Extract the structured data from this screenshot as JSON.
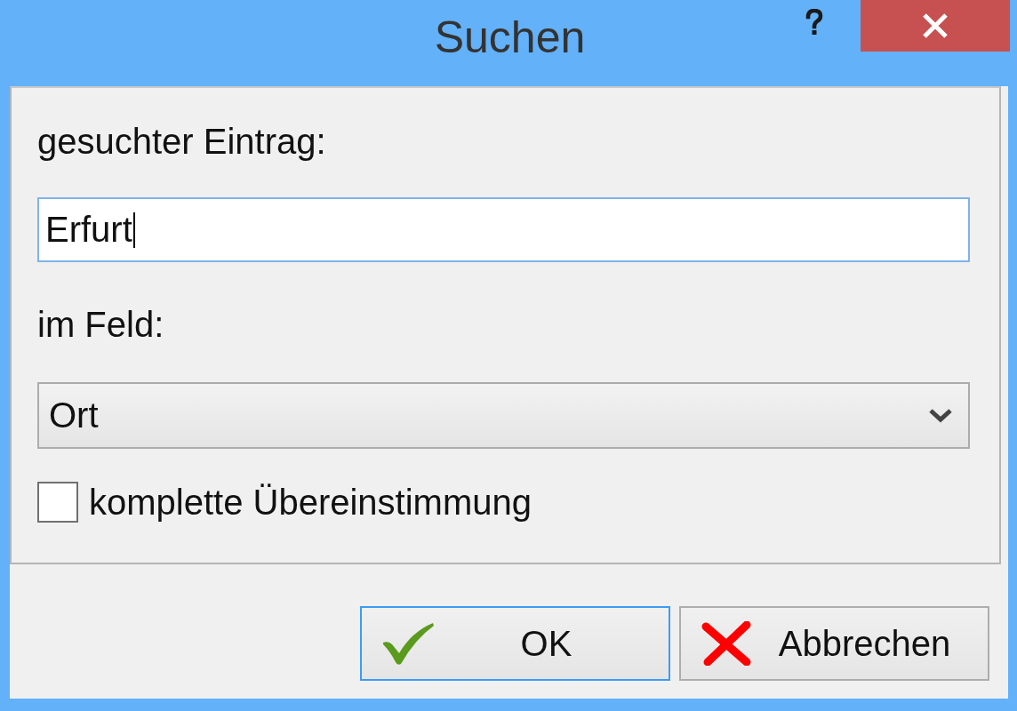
{
  "window": {
    "title": "Suchen"
  },
  "search": {
    "label": "gesuchter Eintrag:",
    "value": "Erfurt",
    "focused": true
  },
  "field": {
    "label": "im Feld:",
    "value": "Ort"
  },
  "exact_match": {
    "label": "komplette Übereinstimmung",
    "checked": false
  },
  "buttons": [
    {
      "label": "OK",
      "kind": "confirm",
      "default": true
    },
    {
      "label": "Abbrechen",
      "kind": "cancel",
      "default": false
    }
  ]
}
